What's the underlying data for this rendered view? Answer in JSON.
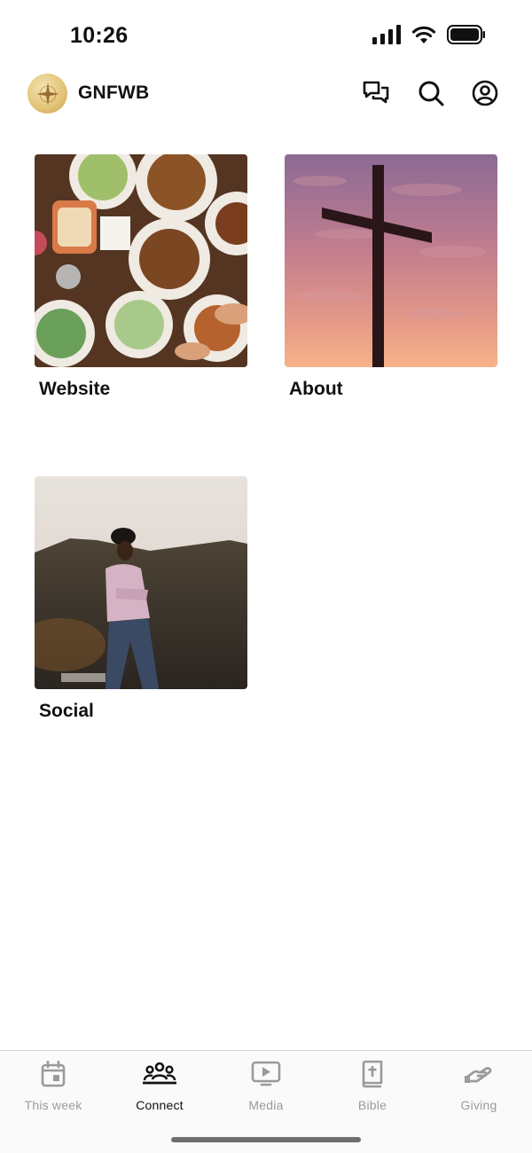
{
  "status": {
    "time": "10:26"
  },
  "header": {
    "title": "GNFWB"
  },
  "tiles": [
    {
      "label": "Website"
    },
    {
      "label": "About"
    },
    {
      "label": "Social"
    }
  ],
  "tabs": [
    {
      "label": "This week",
      "icon": "calendar-icon",
      "active": false
    },
    {
      "label": "Connect",
      "icon": "people-icon",
      "active": true
    },
    {
      "label": "Media",
      "icon": "play-screen-icon",
      "active": false
    },
    {
      "label": "Bible",
      "icon": "bible-icon",
      "active": false
    },
    {
      "label": "Giving",
      "icon": "giving-hand-icon",
      "active": false
    }
  ],
  "colors": {
    "active": "#111111",
    "inactive": "#9a9a9a",
    "logo_gold": "#e2c275"
  }
}
